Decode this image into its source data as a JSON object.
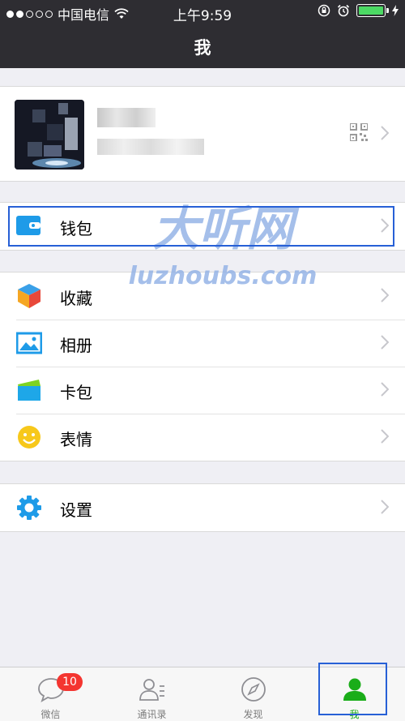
{
  "status_bar": {
    "carrier": "中国电信",
    "time": "上午9:59",
    "signal_dots_filled": 2,
    "signal_dots_total": 5,
    "battery_level": 1.0,
    "battery_color": "#4cd964"
  },
  "nav": {
    "title": "我"
  },
  "profile": {
    "qr_icon": "qr-code-icon"
  },
  "wallet_group": [
    {
      "label": "钱包",
      "icon": "wallet-icon"
    }
  ],
  "main_group": [
    {
      "label": "收藏",
      "icon": "favorites-cube-icon"
    },
    {
      "label": "相册",
      "icon": "album-picture-icon"
    },
    {
      "label": "卡包",
      "icon": "card-pack-icon"
    },
    {
      "label": "表情",
      "icon": "sticker-smile-icon"
    }
  ],
  "settings_group": [
    {
      "label": "设置",
      "icon": "settings-gear-icon"
    }
  ],
  "tab_bar": {
    "tabs": [
      {
        "label": "微信",
        "icon": "chat-bubble-icon",
        "badge": "10"
      },
      {
        "label": "通讯录",
        "icon": "contacts-icon"
      },
      {
        "label": "发现",
        "icon": "compass-icon"
      },
      {
        "label": "我",
        "icon": "me-person-icon",
        "active": true
      }
    ],
    "active_color": "#1aad19"
  },
  "watermark": {
    "title": "大听网",
    "url": "luzhoubs.com",
    "color": "#8fb0e6"
  },
  "highlight_color": "#2760d6"
}
